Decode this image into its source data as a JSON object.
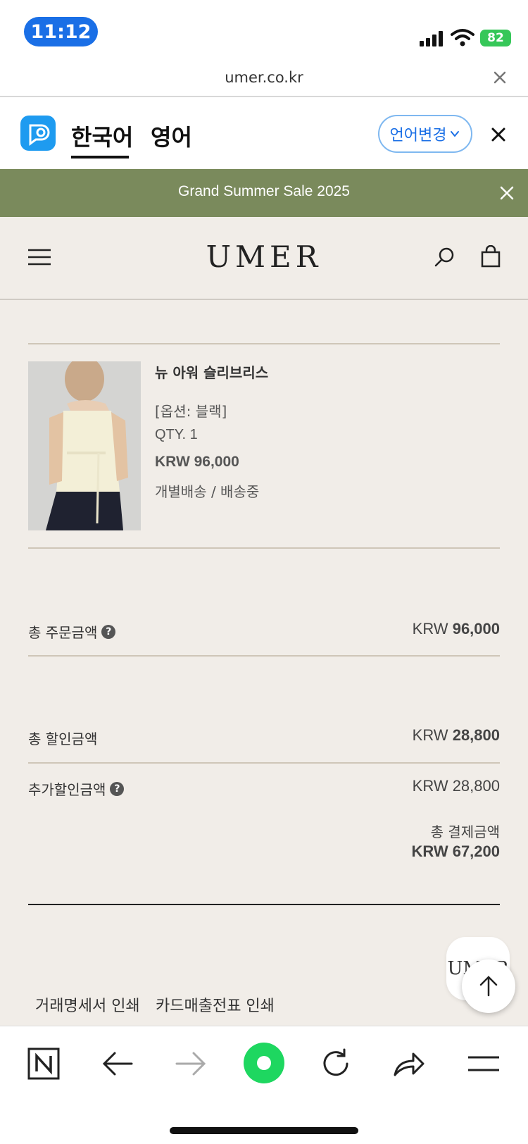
{
  "status_bar": {
    "time": "11:12",
    "battery": "82"
  },
  "url_bar": {
    "url": "umer.co.kr"
  },
  "translate_bar": {
    "tab_korean": "한국어",
    "tab_english": "영어",
    "change_language": "언어변경"
  },
  "promo": {
    "text": "Grand Summer Sale 2025"
  },
  "site": {
    "logo": "UMER"
  },
  "product": {
    "name": "뉴 아워 슬리브리스",
    "option": "[옵션: 블랙]",
    "qty": "QTY. 1",
    "price": "KRW 96,000",
    "shipping": "개별배송 / 배송중"
  },
  "summary": {
    "order_total_label": "총 주문금액",
    "order_total_currency": "KRW",
    "order_total_amount": "96,000",
    "discount_label": "총 할인금액",
    "discount_currency": "KRW",
    "discount_amount": "28,800",
    "extra_discount_label": "추가할인금액",
    "extra_discount_value": "KRW 28,800",
    "payment_label": "총 결제금액",
    "payment_value": "KRW 67,200"
  },
  "actions": {
    "print_statement": "거래명세서 인쇄",
    "print_receipt": "카드매출전표 인쇄"
  },
  "fab": {
    "brand": "UMER"
  },
  "colors": {
    "promo_bg": "#7a8a5c",
    "page_bg": "#f1ede8",
    "accent_blue": "#1a6fe6",
    "green": "#1ed760"
  }
}
